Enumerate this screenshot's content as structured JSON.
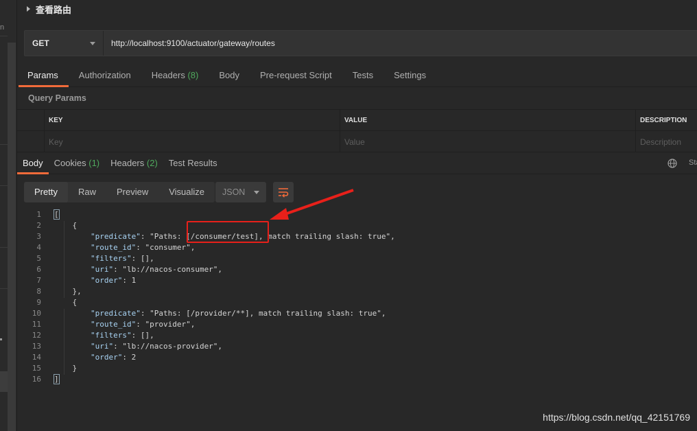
{
  "request": {
    "title": "查看路由",
    "method": "GET",
    "url": "http://localhost:9100/actuator/gateway/routes"
  },
  "request_tabs": [
    {
      "label": "Params",
      "active": true
    },
    {
      "label": "Authorization"
    },
    {
      "label": "Headers",
      "count": "(8)"
    },
    {
      "label": "Body"
    },
    {
      "label": "Pre-request Script"
    },
    {
      "label": "Tests"
    },
    {
      "label": "Settings"
    }
  ],
  "query_params": {
    "title": "Query Params",
    "headers": {
      "key": "KEY",
      "value": "VALUE",
      "description": "DESCRIPTION"
    },
    "placeholders": {
      "key": "Key",
      "value": "Value",
      "description": "Description"
    }
  },
  "response_tabs": [
    {
      "label": "Body",
      "active": true
    },
    {
      "label": "Cookies",
      "count": "(1)"
    },
    {
      "label": "Headers",
      "count": "(2)"
    },
    {
      "label": "Test Results"
    }
  ],
  "status_stub": "Sta",
  "view_modes": [
    "Pretty",
    "Raw",
    "Preview",
    "Visualize"
  ],
  "format": "JSON",
  "body_lines": [
    {
      "n": "1",
      "t": "["
    },
    {
      "n": "2",
      "t": "    {"
    },
    {
      "n": "3",
      "t": "        \"predicate\": \"Paths: [/consumer/test], match trailing slash: true\","
    },
    {
      "n": "4",
      "t": "        \"route_id\": \"consumer\","
    },
    {
      "n": "5",
      "t": "        \"filters\": [],"
    },
    {
      "n": "6",
      "t": "        \"uri\": \"lb://nacos-consumer\","
    },
    {
      "n": "7",
      "t": "        \"order\": 1"
    },
    {
      "n": "8",
      "t": "    },"
    },
    {
      "n": "9",
      "t": "    {"
    },
    {
      "n": "10",
      "t": "        \"predicate\": \"Paths: [/provider/**], match trailing slash: true\","
    },
    {
      "n": "11",
      "t": "        \"route_id\": \"provider\","
    },
    {
      "n": "12",
      "t": "        \"filters\": [],"
    },
    {
      "n": "13",
      "t": "        \"uri\": \"lb://nacos-provider\","
    },
    {
      "n": "14",
      "t": "        \"order\": 2"
    },
    {
      "n": "15",
      "t": "    }"
    },
    {
      "n": "16",
      "t": "]"
    }
  ],
  "annotation_color": "#e8201a",
  "accent": "#f26b3a",
  "count_color": "#4faa5d",
  "sidebar_char": "n",
  "watermark": "https://blog.csdn.net/qq_42151769"
}
